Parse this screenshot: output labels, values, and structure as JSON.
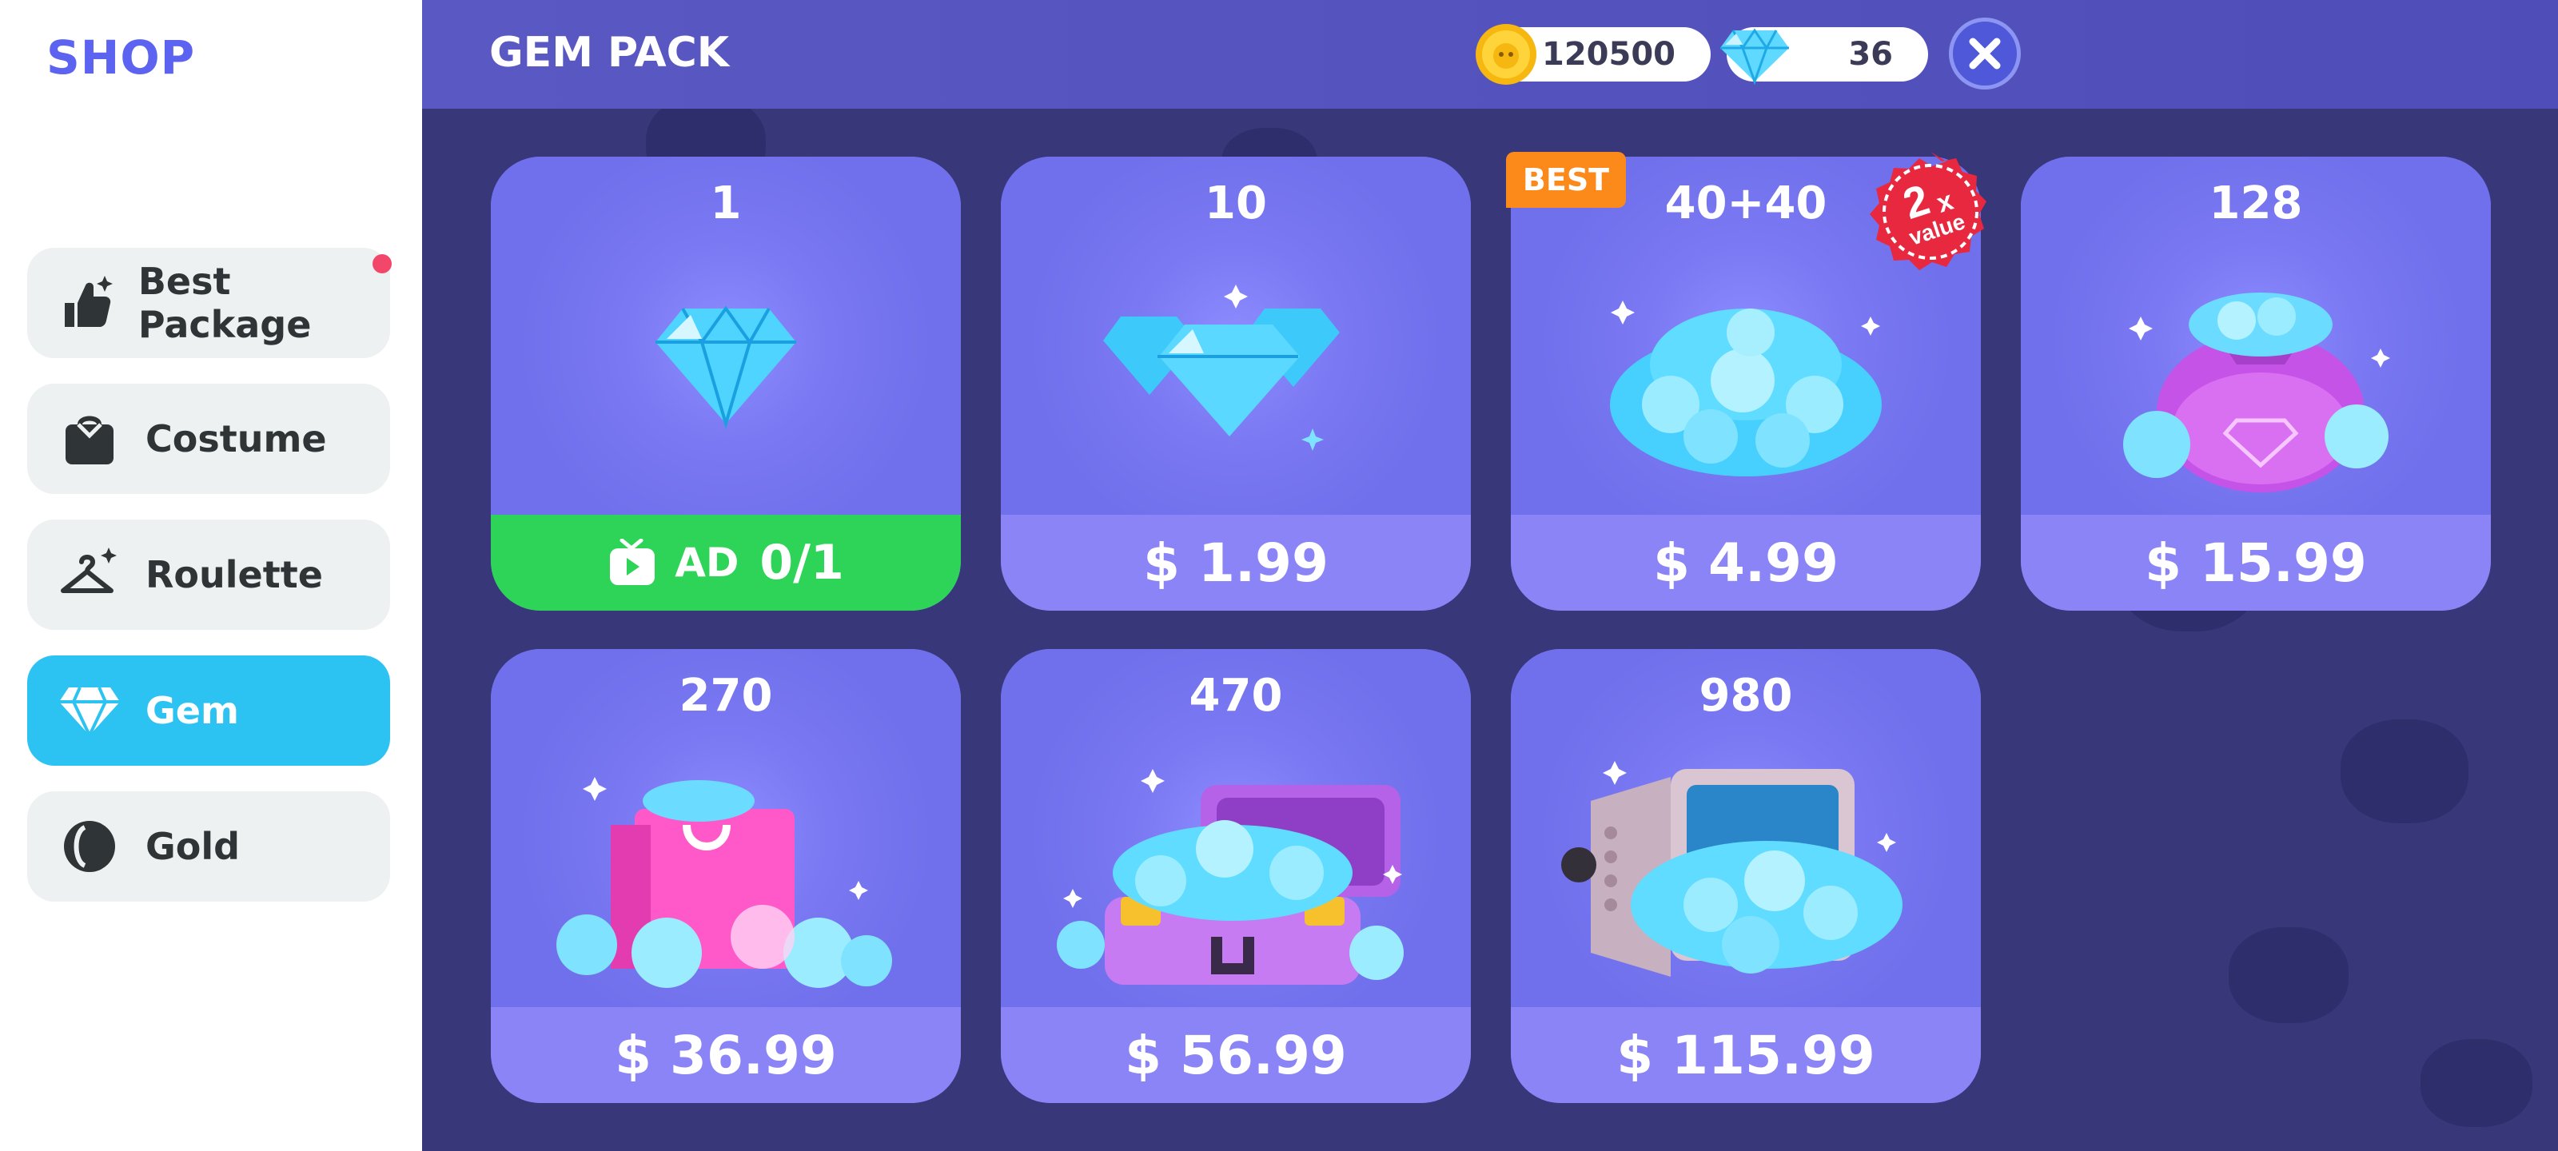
{
  "sidebar": {
    "title": "SHOP",
    "items": [
      {
        "label": "Best Package",
        "icon": "thumbs-up-icon",
        "notification": true
      },
      {
        "label": "Costume",
        "icon": "shirt-icon"
      },
      {
        "label": "Roulette",
        "icon": "hanger-icon"
      },
      {
        "label": "Gem",
        "icon": "diamond-icon",
        "active": true
      },
      {
        "label": "Gold",
        "icon": "coin-icon"
      }
    ]
  },
  "header": {
    "title": "GEM PACK",
    "gold": "120500",
    "gems": "36",
    "close_icon": "close-icon"
  },
  "colors": {
    "accent": "#2cc3f2",
    "title": "#5b63f0",
    "background": "#383779",
    "card": "#7272ee",
    "ad_green": "#2ed457",
    "best_tag": "#fb8a1b",
    "value_badge": "#e8283f"
  },
  "packs": [
    {
      "count": "1",
      "ad_label": "AD",
      "ad_count": "0/1"
    },
    {
      "count": "10",
      "price": "$ 1.99"
    },
    {
      "count": "40+40",
      "price": "$ 4.99",
      "tag": "BEST",
      "badge_number": "2",
      "badge_x": "x",
      "badge_text": "value"
    },
    {
      "count": "128",
      "price": "$ 15.99"
    },
    {
      "count": "270",
      "price": "$ 36.99"
    },
    {
      "count": "470",
      "price": "$ 56.99"
    },
    {
      "count": "980",
      "price": "$ 115.99"
    }
  ]
}
